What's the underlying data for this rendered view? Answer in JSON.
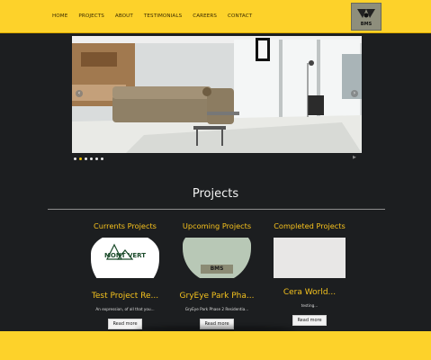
{
  "nav": {
    "items": [
      "HOME",
      "PROJECTS",
      "ABOUT",
      "TESTIMONIALS",
      "CAREERS",
      "CONTACT"
    ]
  },
  "logo": {
    "text": "BMS"
  },
  "slider": {
    "dots": 6,
    "active_dot": 1,
    "prev": "‹",
    "next": "›",
    "play": "▶"
  },
  "section": {
    "title": "Projects",
    "columns": [
      {
        "heading": "Currents Projects",
        "image_label": "MONT VERT",
        "title": "Test Project Re...",
        "desc": "An expression, of all that you...",
        "button": "Read more"
      },
      {
        "heading": "Upcoming Projects",
        "image_label": "BMS",
        "title": "GryEye Park Pha...",
        "desc": "GryEye Park Phase 2 Residentia...",
        "button": "Read more"
      },
      {
        "heading": "Completed Projects",
        "image_label": "",
        "title": "Cera World...",
        "desc": "testing...",
        "button": "Read more"
      }
    ]
  },
  "colors": {
    "accent": "#fdd22a",
    "background": "#1c1e20",
    "heading": "#f7c21d"
  }
}
